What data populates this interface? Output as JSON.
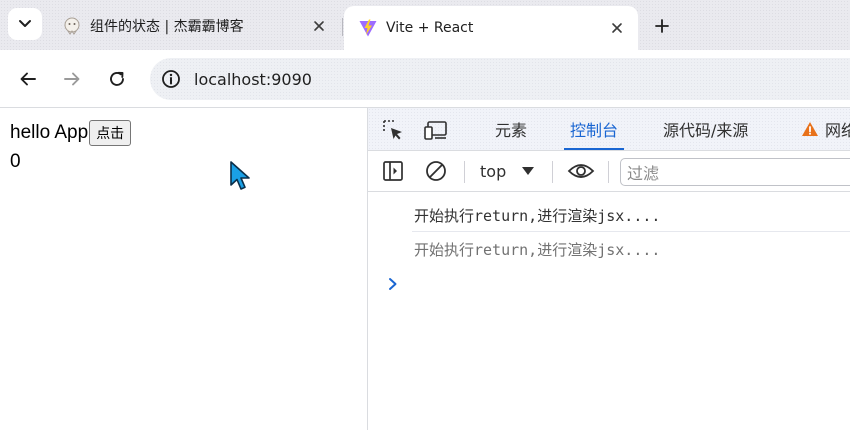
{
  "browser": {
    "tabs": [
      {
        "title": "组件的状态 | 杰霸霸博客",
        "favicon": "ghost-favicon-icon",
        "active": false
      },
      {
        "title": "Vite + React",
        "favicon": "vite-logo-icon",
        "active": true
      }
    ],
    "new_tab_icon": "plus-icon",
    "url": "localhost:9090"
  },
  "page": {
    "heading_text": "hello App",
    "button_label": "点击",
    "count": "0"
  },
  "devtools": {
    "tabs": [
      "元素",
      "控制台",
      "源代码/来源",
      "网络"
    ],
    "selected_tab": "控制台",
    "context": "top",
    "filter_placeholder": "过滤",
    "logs": [
      "开始执行return,进行渲染jsx....",
      "开始执行return,进行渲染jsx...."
    ],
    "accent_color": "#1a66d2",
    "warning_color": "#e8711a"
  }
}
